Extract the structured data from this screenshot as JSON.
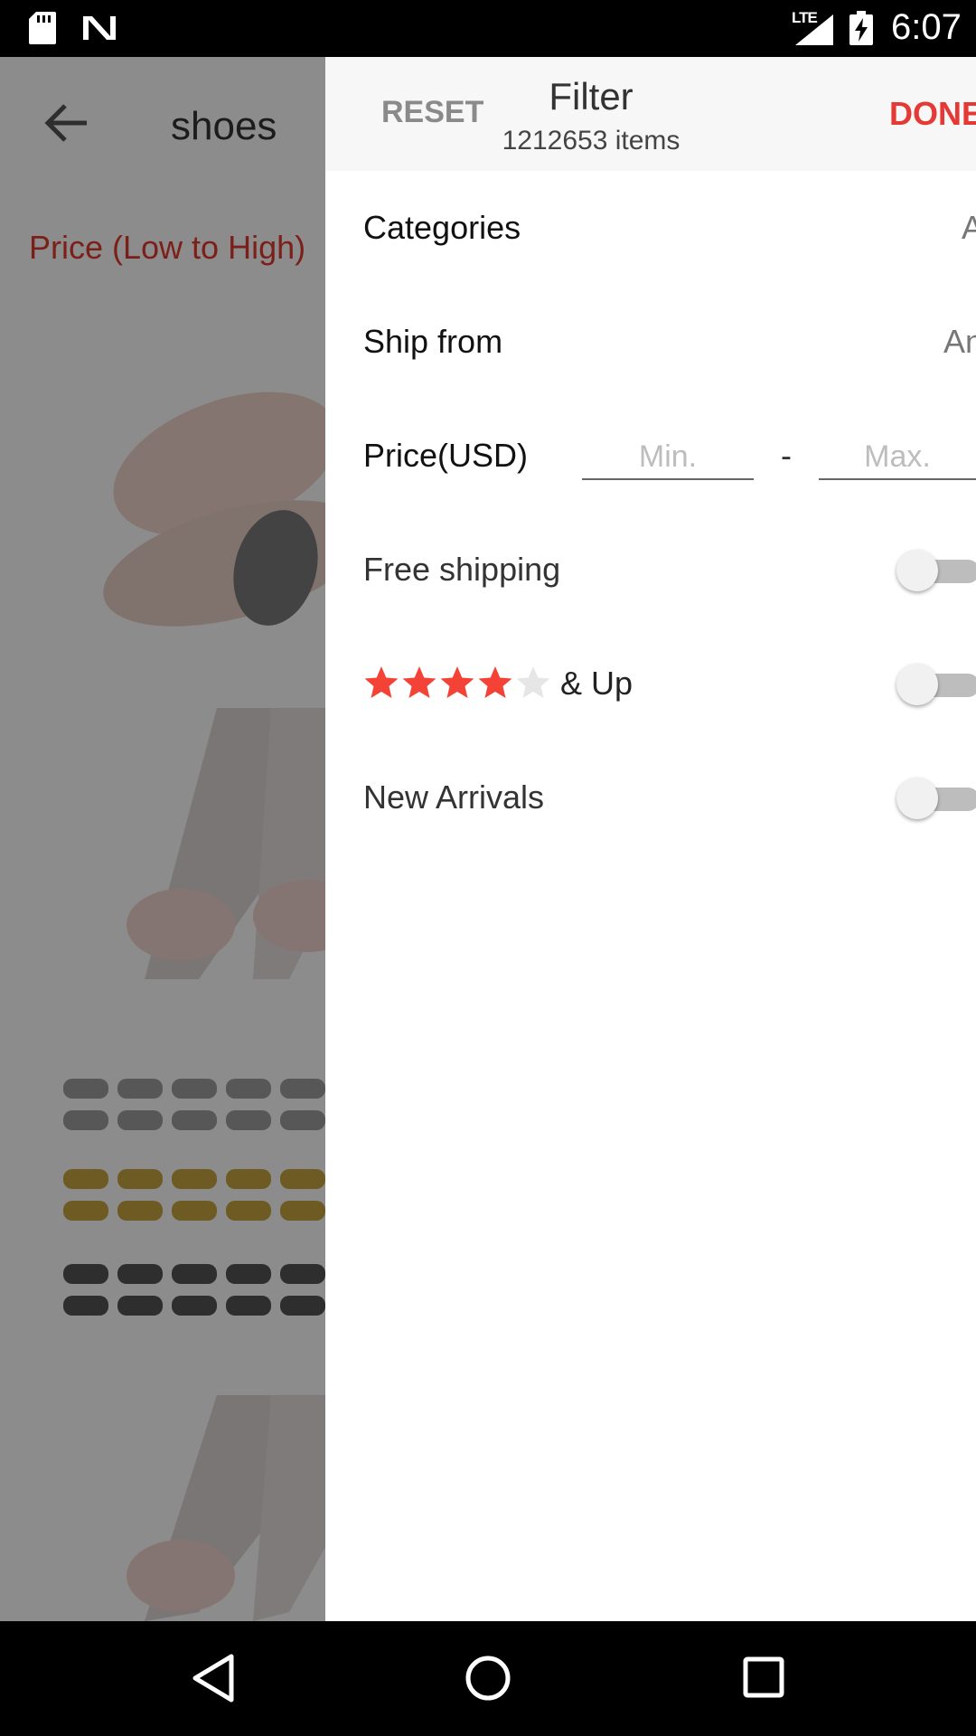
{
  "status_bar": {
    "network": "LTE",
    "time": "6:07",
    "icons": [
      "sd-card-icon",
      "n-logo-icon",
      "signal-icon",
      "battery-charging-icon"
    ]
  },
  "background": {
    "search_query": "shoes",
    "sort_label": "Price (Low to High)"
  },
  "filter": {
    "reset_label": "RESET",
    "title": "Filter",
    "count": "1212653 items",
    "done_label": "DONE",
    "categories": {
      "label": "Categories",
      "value": "All"
    },
    "ship_from": {
      "label": "Ship from",
      "value": "Any"
    },
    "price": {
      "label": "Price(USD)",
      "min_placeholder": "Min.",
      "max_placeholder": "Max.",
      "separator": "-"
    },
    "free_shipping": {
      "label": "Free shipping",
      "enabled": false
    },
    "rating": {
      "stars_filled": 4,
      "stars_total": 5,
      "label": "& Up",
      "enabled": false,
      "star_color": "#f44336"
    },
    "new_arrivals": {
      "label": "New Arrivals",
      "enabled": false
    }
  },
  "colors": {
    "accent": "#e53935",
    "sort": "#e23a2e"
  }
}
